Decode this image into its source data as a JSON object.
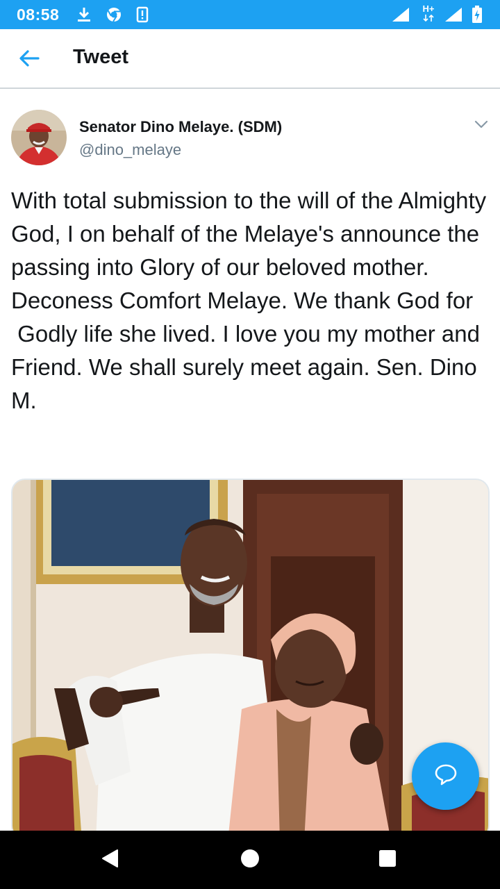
{
  "status_bar": {
    "time": "08:58",
    "icons": [
      "download-icon",
      "chrome-icon",
      "sim-alert-icon",
      "signal-icon",
      "network-type-icon",
      "signal-icon-2",
      "battery-charging-icon"
    ],
    "network_type": "H+"
  },
  "app_bar": {
    "back_icon": "arrow-left-icon",
    "title": "Tweet"
  },
  "tweet": {
    "author_name": "Senator Dino Melaye. (SDM)",
    "author_handle": "@dino_melaye",
    "menu_icon": "chevron-down-icon",
    "text": "With total submission to the will of the Almighty God, I on behalf of the Melaye's announce the passing into Glory of our beloved mother. Deconess Comfort Melaye. We thank God for\n Godly life she lived. I love you my mother and Friend. We shall surely meet again. Sen. Dino M."
  },
  "fab": {
    "icon": "compose-reply-icon"
  },
  "nav_bar": {
    "buttons": [
      "back-triangle-icon",
      "home-circle-icon",
      "recents-square-icon"
    ]
  },
  "colors": {
    "accent": "#1da1f2",
    "text_primary": "#14171a",
    "text_secondary": "#657786"
  }
}
